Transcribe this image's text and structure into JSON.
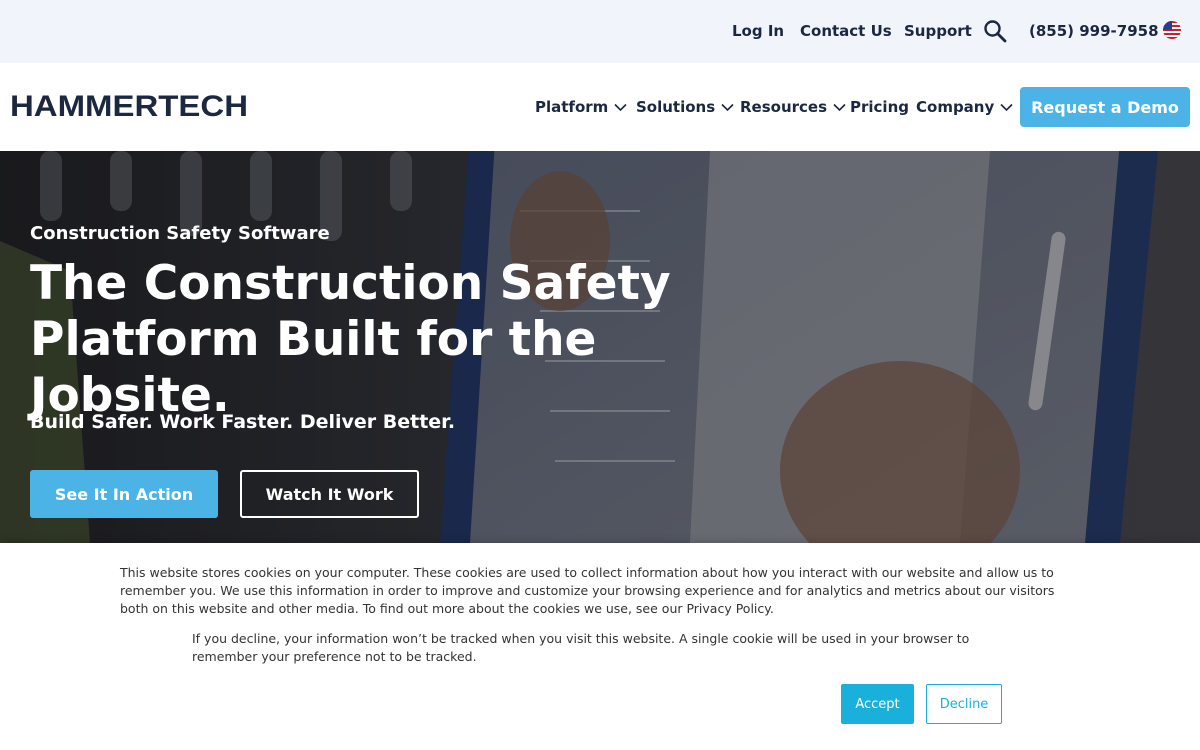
{
  "topbar": {
    "login": "Log In",
    "contact": "Contact Us",
    "support": "Support",
    "phone": "(855) 999-7958",
    "search_icon": "search-icon",
    "flag_icon": "us-flag-icon"
  },
  "nav": {
    "logo": "HAMMERTECH",
    "items": [
      {
        "label": "Platform"
      },
      {
        "label": "Solutions"
      },
      {
        "label": "Resources"
      },
      {
        "label": "Pricing"
      },
      {
        "label": "Company"
      }
    ],
    "cta": "Request a Demo"
  },
  "hero": {
    "eyebrow": "Construction Safety Software",
    "title_line1": "The Construction Safety",
    "title_line2": "Platform Built for the Jobsite.",
    "subtitle": "Build Safer. Work Faster. Deliver Better.",
    "primary_cta": "See It In Action",
    "secondary_cta": "Watch It Work"
  },
  "cookie": {
    "paragraph1": "This website stores cookies on your computer. These cookies are used to collect information about how you interact with our website and allow us to remember you. We use this information in order to improve and customize your browsing experience and for analytics and metrics about our visitors both on this website and other media. To find out more about the cookies we use, see our Privacy Policy.",
    "paragraph2": "If you decline, your information won’t be tracked when you visit this website. A single cookie will be used in your browser to remember your preference not to be tracked.",
    "accept": "Accept",
    "decline": "Decline"
  },
  "colors": {
    "brand_navy": "#1c2740",
    "accent_blue": "#4cb3e6",
    "cookie_blue": "#1ab0dc",
    "topbar_bg": "#f1f4fa"
  }
}
